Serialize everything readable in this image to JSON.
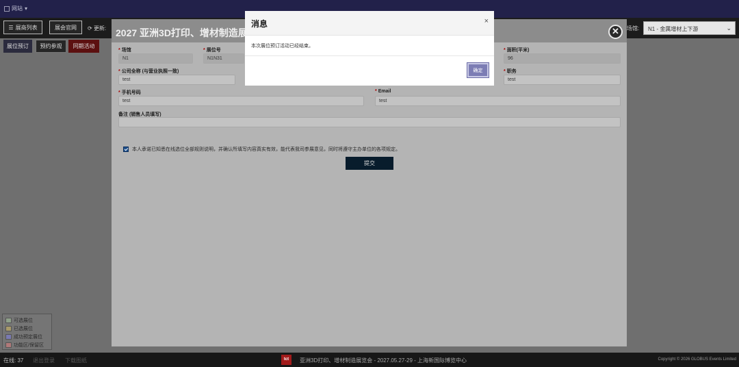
{
  "topnav": {
    "site_label": "网站",
    "site_icon": "grid-icon"
  },
  "toolbar": {
    "stand_list": "展商列表",
    "meeting": "展会官网",
    "refresh_label": "更新:",
    "venue_label": "场馆:",
    "venue_value": "N1 - 金属增材上下游"
  },
  "side_buttons": {
    "reserve": "展位预订",
    "reserve_history": "预约参观",
    "sync": "同期活动"
  },
  "stand_form": {
    "title": "2027 亚洲3D打印、增材制造展览",
    "hall": {
      "label": "场馆",
      "value": "N1"
    },
    "stand_no": {
      "label": "展位号",
      "value": "N1N31"
    },
    "area": {
      "label": "面积(平米)",
      "value": "96"
    },
    "company": {
      "label": "公司全称 (与营业执照一致)",
      "value": "test"
    },
    "position": {
      "label": "职务",
      "value": "test"
    },
    "phone": {
      "label": "手机号码",
      "value": "test"
    },
    "email": {
      "label": "Email",
      "value": "test"
    },
    "remark": {
      "label": "备注 (销售人员填写)",
      "value": ""
    },
    "agree_text": "本人承诺已知悉在线选位全部规则说明，并确认所填写内容真实有效，能代表我司参展意见，同时将遵守主办单位的各项规定。",
    "submit": "提交"
  },
  "legend": [
    {
      "label": "可选展位",
      "color": "#8fa08a"
    },
    {
      "label": "已选展位",
      "color": "#a89a6a"
    },
    {
      "label": "成功预定展位",
      "color": "#7a7ab2"
    },
    {
      "label": "功能区/保留区",
      "color": "#b07a7a"
    }
  ],
  "footer": {
    "online": "在线: 37",
    "logout": "退出登录",
    "download": "下载图纸",
    "logo_text": "tct",
    "info": "亚洲3D打印、增材制造展览会 - 2027.05.27-29 - 上海新国际博览中心",
    "copyright": "Copyright © 2026 GLOBUS Events Limited"
  },
  "dialog": {
    "title": "消息",
    "close": "×",
    "message": "本次展位预订活动已经结束。",
    "ok": "确定"
  }
}
